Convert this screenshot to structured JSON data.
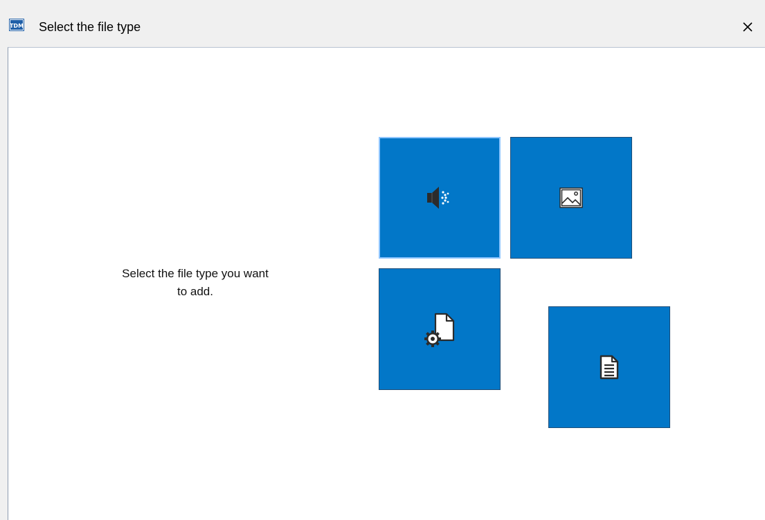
{
  "window": {
    "title": "Select the file type",
    "app_icon": "tdm-app-icon",
    "close_icon": "close-icon"
  },
  "main": {
    "prompt": "Select the file type you want\nto add.",
    "tiles": [
      {
        "type": "audio",
        "icon": "speaker-icon",
        "selected": true
      },
      {
        "type": "image",
        "icon": "image-icon",
        "selected": false
      },
      {
        "type": "settings-file",
        "icon": "file-gear-icon",
        "selected": false
      },
      {
        "type": "document",
        "icon": "document-icon",
        "selected": false
      }
    ]
  },
  "colors": {
    "tile": "#0277c8",
    "tile_border": "#1e4d77",
    "selected_border": "#8fc6ff"
  }
}
